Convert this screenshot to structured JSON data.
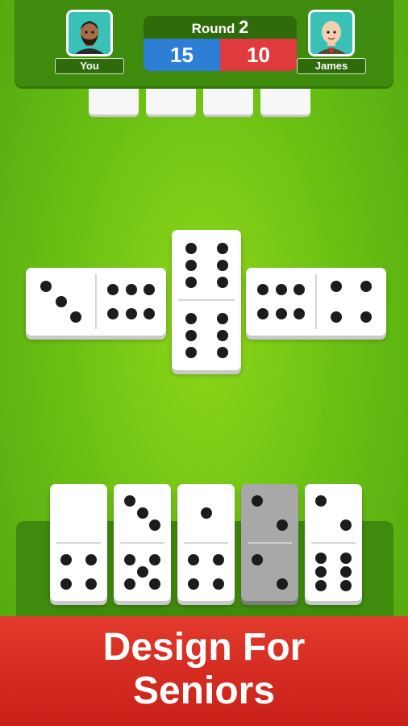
{
  "header": {
    "round_label": "Round",
    "round_number": "2",
    "player_name": "You",
    "opponent_name": "James",
    "player_score": "15",
    "opponent_score": "10"
  },
  "colors": {
    "felt": "#6cc214",
    "panel": "#3f8b0d",
    "player_score_bg": "#2d7fd6",
    "opponent_score_bg": "#e03a3e",
    "banner": "#d42a20"
  },
  "opponent_hand_count": 4,
  "board": [
    {
      "orientation": "horizontal",
      "ends": [
        3,
        6
      ]
    },
    {
      "orientation": "vertical",
      "ends": [
        6,
        6
      ]
    },
    {
      "orientation": "horizontal",
      "ends": [
        6,
        4
      ]
    }
  ],
  "player_hand": [
    {
      "ends": [
        0,
        4
      ],
      "selected": false
    },
    {
      "ends": [
        3,
        5
      ],
      "selected": false
    },
    {
      "ends": [
        1,
        4
      ],
      "selected": false
    },
    {
      "ends": [
        2,
        2
      ],
      "selected": true
    },
    {
      "ends": [
        2,
        6
      ],
      "selected": false
    }
  ],
  "banner": {
    "line1": "Design For",
    "line2": "Seniors"
  }
}
